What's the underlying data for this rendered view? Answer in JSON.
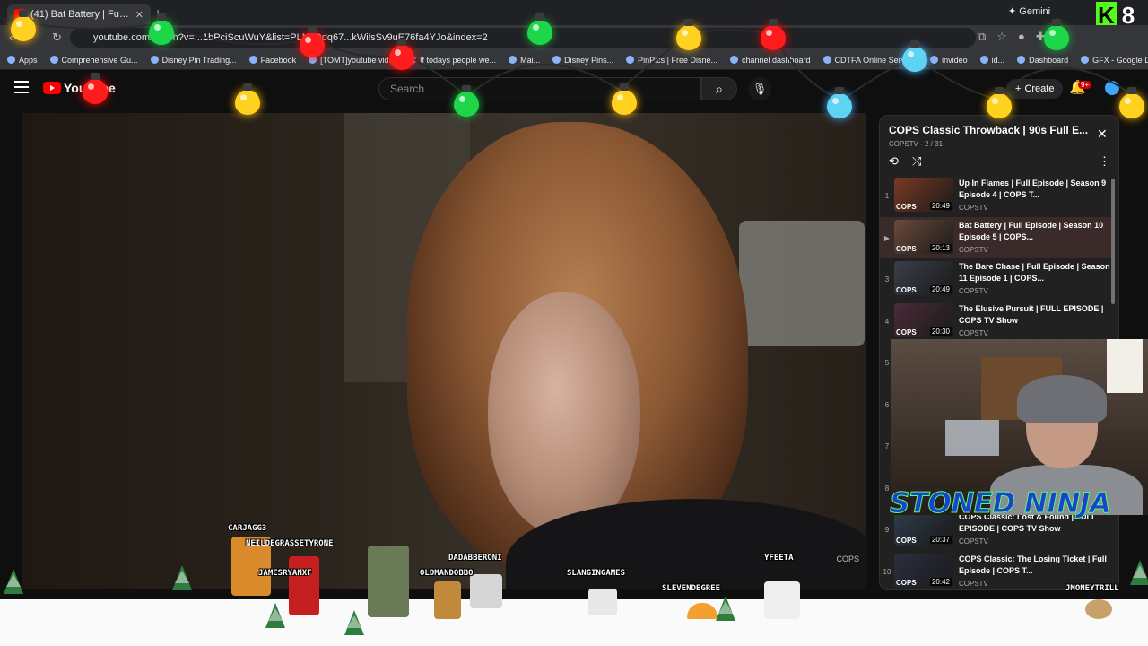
{
  "browser": {
    "tab_title": "(41) Bat Battery | Full Episo",
    "url": "youtube.com/watch?v=...1bPciScuWuY&list=PLNcQdq67...kWilsSv9uE76fa4YJo&index=2",
    "gemini_label": "Gemini",
    "kick_label": "8",
    "bookmarks": [
      "Apps",
      "Comprehensive Gu...",
      "Disney Pin Trading...",
      "Facebook",
      "[TOMT]youtube vid...",
      "If todays people we...",
      "Mai...",
      "Disney Pins...",
      "PinPics | Free Disne...",
      "channel dashboard",
      "CDTFA Online Servic...",
      "invideo",
      "id...",
      "Dashboard",
      "GFX - Google Drive"
    ]
  },
  "youtube": {
    "logo_text": "YouTube",
    "search_placeholder": "Search",
    "create_label": "Create",
    "notif_count": "9+"
  },
  "video": {
    "watermark": "COPS"
  },
  "playlist": {
    "title": "COPS Classic Throwback | 90s Full E...",
    "subtitle": "COPSTV - 2 / 31",
    "items": [
      {
        "idx": "1",
        "title": "Up In Flames | Full Episode | Season 9 Episode 4 | COPS T...",
        "channel": "COPSTV",
        "duration": "20:49",
        "thumb": "#7a3a24"
      },
      {
        "idx": "▶",
        "title": "Bat Battery | Full Episode | Season 10 Episode 5 | COPS...",
        "channel": "COPSTV",
        "duration": "20:13",
        "thumb": "#6a4a3a"
      },
      {
        "idx": "3",
        "title": "The Bare Chase | Full Episode | Season 11 Episode 1 | COPS...",
        "channel": "COPSTV",
        "duration": "20:49",
        "thumb": "#3b3e4a"
      },
      {
        "idx": "4",
        "title": "The Elusive Pursuit | FULL EPISODE | COPS TV Show",
        "channel": "COPSTV",
        "duration": "20:30",
        "thumb": "#4a2b38"
      },
      {
        "idx": "5",
        "title": "",
        "channel": "",
        "duration": "",
        "thumb": "#333"
      },
      {
        "idx": "6",
        "title": "",
        "channel": "",
        "duration": "",
        "thumb": "#333"
      },
      {
        "idx": "7",
        "title": "",
        "channel": "",
        "duration": "",
        "thumb": "#333"
      },
      {
        "idx": "8",
        "title": "",
        "channel": "",
        "duration": "",
        "thumb": "#333"
      },
      {
        "idx": "9",
        "title": "COPS Classic: Lost & Found | FULL EPISODE | COPS TV Show",
        "channel": "COPSTV",
        "duration": "20:37",
        "thumb": "#2f3b4a"
      },
      {
        "idx": "10",
        "title": "COPS Classic: The Losing Ticket | Full Episode | COPS T...",
        "channel": "COPSTV",
        "duration": "20:42",
        "thumb": "#2b2f3f"
      }
    ]
  },
  "overlay": {
    "stream_name": "STONED NINJA",
    "chatters": [
      {
        "name": "CARJAGG3"
      },
      {
        "name": "NEILDEGRASSETYRONE"
      },
      {
        "name": "JAMESRYANXF"
      },
      {
        "name": "DADABBERONI"
      },
      {
        "name": "OLDMANDOBBO"
      },
      {
        "name": "SLANGINGAMES"
      },
      {
        "name": "YFEETA"
      },
      {
        "name": "SLEVENDEGREE"
      },
      {
        "name": "JMONEYTRILL"
      }
    ]
  },
  "colors": {
    "yt_red": "#ff0000",
    "overlay_green": "#4eff71",
    "overlay_blue": "#1e3fd2"
  }
}
